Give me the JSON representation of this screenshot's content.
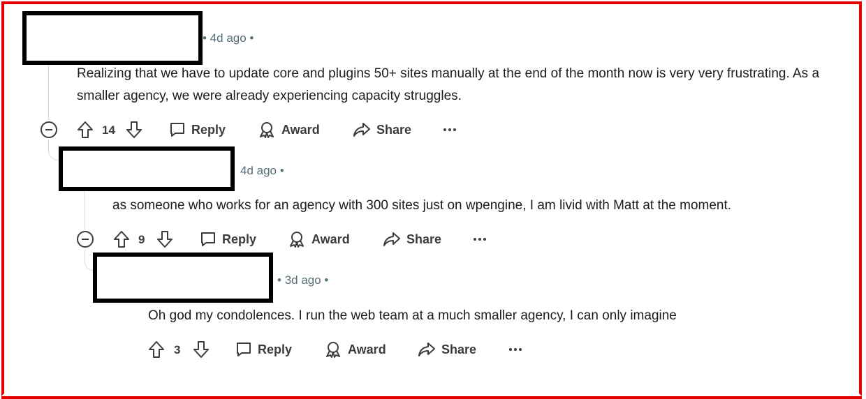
{
  "comments": [
    {
      "age": "4d ago",
      "text": "Realizing that we have to update core and plugins 50+ sites manually at the end of the month now is very very frustrating. As a smaller agency, we were already experiencing capacity struggles.",
      "votes": "14",
      "actions": {
        "reply": "Reply",
        "award": "Award",
        "share": "Share"
      }
    },
    {
      "age": "4d ago",
      "text": "as someone who works for an agency with 300 sites just on wpengine, I am livid with Matt at the moment.",
      "votes": "9",
      "actions": {
        "reply": "Reply",
        "award": "Award",
        "share": "Share"
      }
    },
    {
      "age": "3d ago",
      "text": "Oh god my condolences. I run the web team at a much smaller agency, I can only imagine",
      "votes": "3",
      "actions": {
        "reply": "Reply",
        "award": "Award",
        "share": "Share"
      }
    }
  ],
  "meta_dot": "•",
  "icons": [
    "upvote-icon",
    "downvote-icon",
    "reply-bubble-icon",
    "award-icon",
    "share-arrow-icon",
    "more-dots-icon",
    "collapse-minus-icon"
  ],
  "colors": {
    "frame": "#e50000",
    "redaction": "#000000",
    "meta": "#576f76",
    "action": "#3c3c3c",
    "thread": "#d7dadc"
  }
}
